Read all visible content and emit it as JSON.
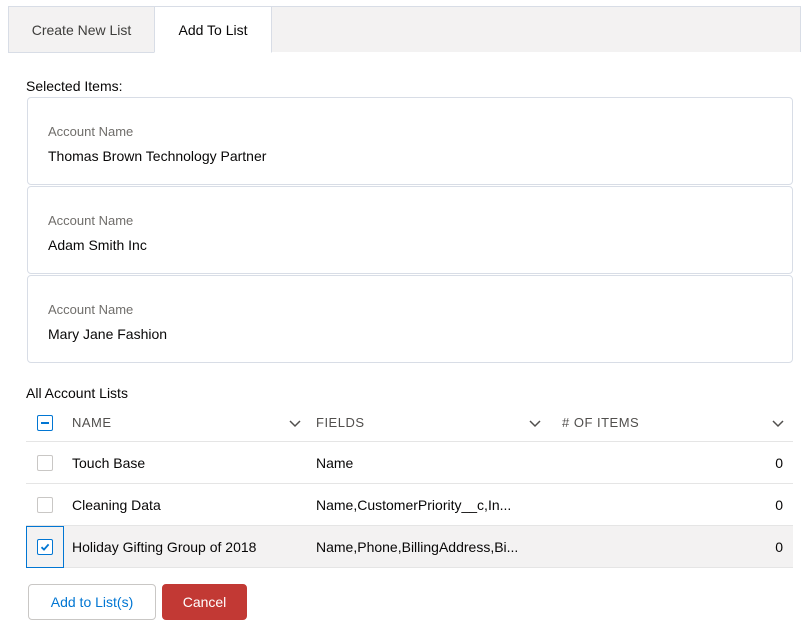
{
  "tabs": [
    {
      "label": "Create New List",
      "active": false
    },
    {
      "label": "Add To List",
      "active": true
    }
  ],
  "selected_items": {
    "label": "Selected Items:",
    "items": [
      {
        "field_label": "Account Name",
        "value": "Thomas Brown Technology Partner"
      },
      {
        "field_label": "Account Name",
        "value": "Adam Smith Inc"
      },
      {
        "field_label": "Account Name",
        "value": "Mary Jane Fashion"
      }
    ]
  },
  "lists": {
    "label": "All Account Lists",
    "columns": [
      "NAME",
      "FIELDS",
      "# OF ITEMS"
    ],
    "rows": [
      {
        "name": "Touch Base",
        "fields": "Name",
        "items": "0",
        "checked": false
      },
      {
        "name": "Cleaning Data",
        "fields": "Name,CustomerPriority__c,In...",
        "items": "0",
        "checked": false
      },
      {
        "name": "Holiday Gifting Group of 2018",
        "fields": "Name,Phone,BillingAddress,Bi...",
        "items": "0",
        "checked": true
      }
    ]
  },
  "buttons": {
    "add": "Add to List(s)",
    "cancel": "Cancel"
  },
  "icons": {
    "chevron": "chevron-down-icon",
    "check": "check-icon",
    "minus": "minus-icon"
  },
  "colors": {
    "brand": "#0176d3",
    "destructive": "#c23934"
  }
}
